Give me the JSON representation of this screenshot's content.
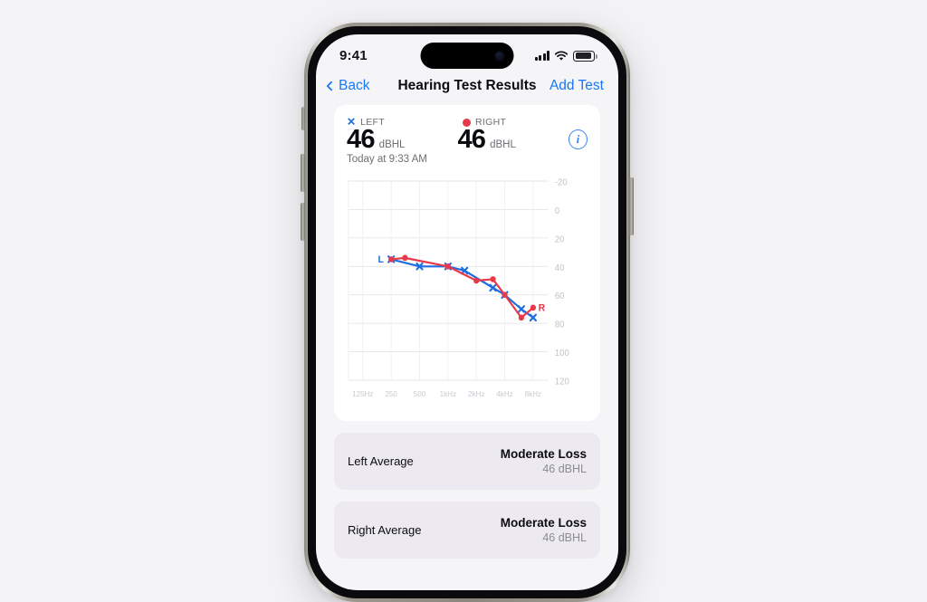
{
  "status_bar": {
    "time": "9:41",
    "signal_icon": "cellular-signal-icon",
    "wifi_icon": "wifi-icon",
    "battery_icon": "battery-icon"
  },
  "nav": {
    "back_label": "Back",
    "title": "Hearing Test Results",
    "action_label": "Add Test"
  },
  "summary": {
    "left": {
      "legend": "LEFT",
      "marker": "x-marker",
      "value": "46",
      "unit": "dBHL",
      "color": "#1d6ee0"
    },
    "right": {
      "legend": "RIGHT",
      "marker": "dot-marker",
      "value": "46",
      "unit": "dBHL",
      "color": "#e8394a"
    },
    "timestamp": "Today at 9:33 AM",
    "info_icon": "info-circle-icon"
  },
  "averages": [
    {
      "label": "Left Average",
      "grade": "Moderate Loss",
      "value": "46 dBHL"
    },
    {
      "label": "Right Average",
      "grade": "Moderate Loss",
      "value": "46 dBHL"
    }
  ],
  "chart_data": {
    "type": "line",
    "title": "",
    "xlabel": "",
    "ylabel": "",
    "x_tick_labels": [
      "125Hz",
      "250",
      "500",
      "1kHz",
      "2kHz",
      "4kHz",
      "8kHz"
    ],
    "x_tick_values": [
      125,
      250,
      500,
      1000,
      2000,
      4000,
      8000
    ],
    "y_ticks": [
      -20,
      0,
      20,
      40,
      60,
      80,
      100,
      120
    ],
    "ylim": [
      -20,
      120
    ],
    "y_inverted": false,
    "grid": true,
    "legend_position": "inline-endpoint-labels",
    "endpoint_labels": [
      {
        "text": "L",
        "color": "#1d6ee0",
        "at": "start"
      },
      {
        "text": "R",
        "color": "#e8394a",
        "at": "end"
      }
    ],
    "series": [
      {
        "name": "Left",
        "marker": "x",
        "color": "#1d6ee0",
        "x": [
          250,
          500,
          1000,
          1500,
          3000,
          4000,
          6000,
          8000
        ],
        "values": [
          35,
          40,
          40,
          43,
          55,
          60,
          70,
          76
        ]
      },
      {
        "name": "Right",
        "marker": "circle",
        "color": "#e8394a",
        "x": [
          250,
          350,
          1000,
          2000,
          3000,
          4000,
          6000,
          8000
        ],
        "values": [
          35,
          34,
          40,
          50,
          49,
          60,
          76,
          69
        ]
      }
    ]
  }
}
